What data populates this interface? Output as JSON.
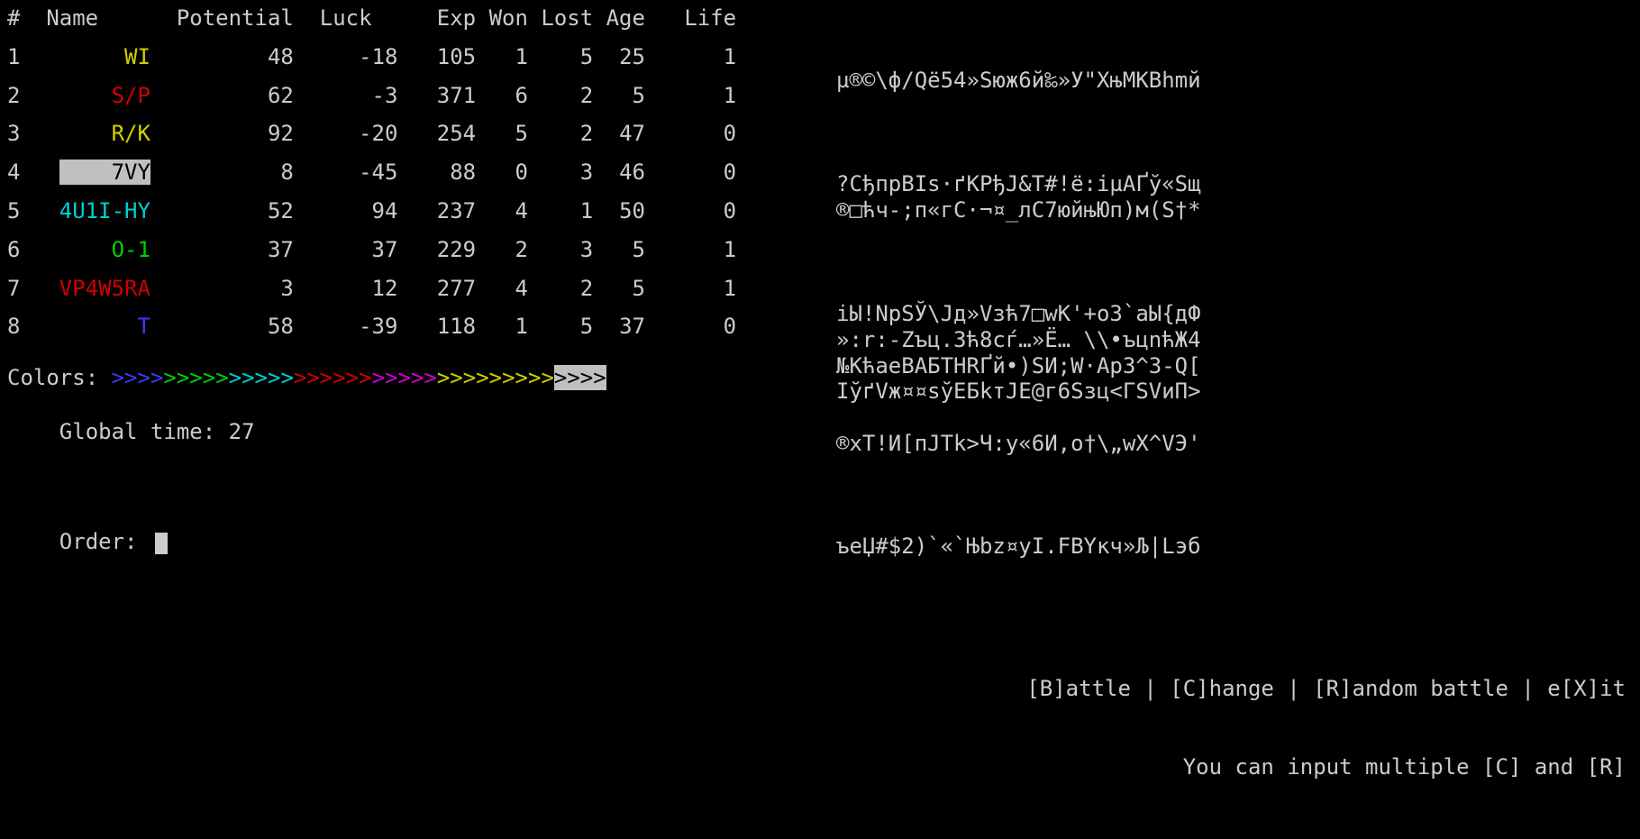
{
  "headers": {
    "idx": "#",
    "name": "Name",
    "potential": "Potential",
    "luck": "Luck",
    "exp": "Exp",
    "won": "Won",
    "lost": "Lost",
    "age": "Age",
    "life": "Life"
  },
  "rows": [
    {
      "idx": "1",
      "name": "WI",
      "name_color": "yellow",
      "sel": false,
      "pot": "48",
      "luck": "-18",
      "exp": "105",
      "won": "1",
      "lost": "5",
      "age": "25",
      "life": "1"
    },
    {
      "idx": "2",
      "name": "S/P",
      "name_color": "red",
      "sel": false,
      "pot": "62",
      "luck": "-3",
      "exp": "371",
      "won": "6",
      "lost": "2",
      "age": "5",
      "life": "1"
    },
    {
      "idx": "3",
      "name": "R/K",
      "name_color": "yellow",
      "sel": false,
      "pot": "92",
      "luck": "-20",
      "exp": "254",
      "won": "5",
      "lost": "2",
      "age": "47",
      "life": "0"
    },
    {
      "idx": "4",
      "name": "7VY",
      "name_color": "white",
      "sel": true,
      "pot": "8",
      "luck": "-45",
      "exp": "88",
      "won": "0",
      "lost": "3",
      "age": "46",
      "life": "0"
    },
    {
      "idx": "5",
      "name": "4U1I-HY",
      "name_color": "cyan",
      "sel": false,
      "pot": "52",
      "luck": "94",
      "exp": "237",
      "won": "4",
      "lost": "1",
      "age": "50",
      "life": "0"
    },
    {
      "idx": "6",
      "name": "O-1",
      "name_color": "green",
      "sel": false,
      "pot": "37",
      "luck": "37",
      "exp": "229",
      "won": "2",
      "lost": "3",
      "age": "5",
      "life": "1"
    },
    {
      "idx": "7",
      "name": "VP4W5RA",
      "name_color": "red",
      "sel": false,
      "pot": "3",
      "luck": "12",
      "exp": "277",
      "won": "4",
      "lost": "2",
      "age": "5",
      "life": "1"
    },
    {
      "idx": "8",
      "name": "T",
      "name_color": "blue",
      "sel": false,
      "pot": "58",
      "luck": "-39",
      "exp": "118",
      "won": "1",
      "lost": "5",
      "age": "37",
      "life": "0"
    }
  ],
  "right_lines": [
    "",
    "µ®©\\ф/Qё54»Sюж6й‰»У\"ХњМКВһmй",
    "",
    "",
    "",
    "?СђпрВІs·ґКРђЈ&Т#!ё:іµАҐў«Sщ",
    "®□ћч-;п«гС·¬¤_лС7юйњЮп)м(S†*",
    "",
    "",
    "",
    "іЫ!NрЅЎ\\Јд»Vзћ7□wК'+о3`аЫ{дФ",
    "»:r:-Zъц.Зћ8сѓ…»Ё… \\\\•ъцnћЖ4",
    "№КћаеВАБТНRҐй•)ЅИ;W·АрЗ^З-Q[",
    "ӀўґVж¤¤ѕўЕБkтЈЕ@г6Sзц<ГЅVиП>",
    "",
    "®хТ!И[пЈТk>Ч:у«6И,о†\\„wХ^VЭ'"
  ],
  "colors_label": "Colors: ",
  "color_chevrons": [
    {
      "color": "blue",
      "count": 4
    },
    {
      "color": "green",
      "count": 5
    },
    {
      "color": "cyan",
      "count": 5
    },
    {
      "color": "red",
      "count": 6
    },
    {
      "color": "magenta",
      "count": 5
    },
    {
      "color": "yellow",
      "count": 9
    },
    {
      "color": "sel",
      "count": 4
    }
  ],
  "global_time_label": "Global time: ",
  "global_time_value": "27",
  "bottom_garble": "ъеЏ#$2)`«`Њbz¤уІ.FВҮкч»Љ|Lэб",
  "order_label": "Order: ",
  "menu_line1": "[B]attle | [C]hange | [R]andom battle | e[X]it",
  "menu_line2": "You can input multiple [C] and [R]"
}
